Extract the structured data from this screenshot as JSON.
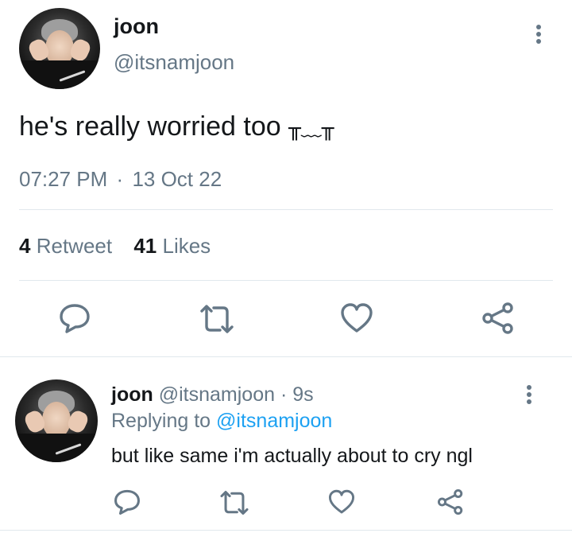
{
  "main_tweet": {
    "author_name": "joon",
    "author_handle": "@itsnamjoon",
    "text": "he's really worried too",
    "emoticon": "╥﹏╥",
    "time": "07:27 PM",
    "separator": "·",
    "date": "13 Oct 22",
    "stats": {
      "retweets_count": "4",
      "retweets_label": "Retweet",
      "likes_count": "41",
      "likes_label": "Likes"
    },
    "actions": [
      "reply-icon",
      "retweet-icon",
      "like-icon",
      "share-icon"
    ]
  },
  "reply_tweet": {
    "author_name": "joon",
    "author_handle": "@itsnamjoon",
    "separator": "·",
    "age": "9s",
    "replying_label": "Replying to",
    "replying_handle": "@itsnamjoon",
    "text": "but like same i'm actually about to cry ngl",
    "actions": [
      "reply-icon",
      "retweet-icon",
      "like-icon",
      "share-icon"
    ]
  },
  "colors": {
    "text": "#14171a",
    "muted": "#657786",
    "link": "#1da1f2",
    "divider": "#e1e8ed"
  }
}
